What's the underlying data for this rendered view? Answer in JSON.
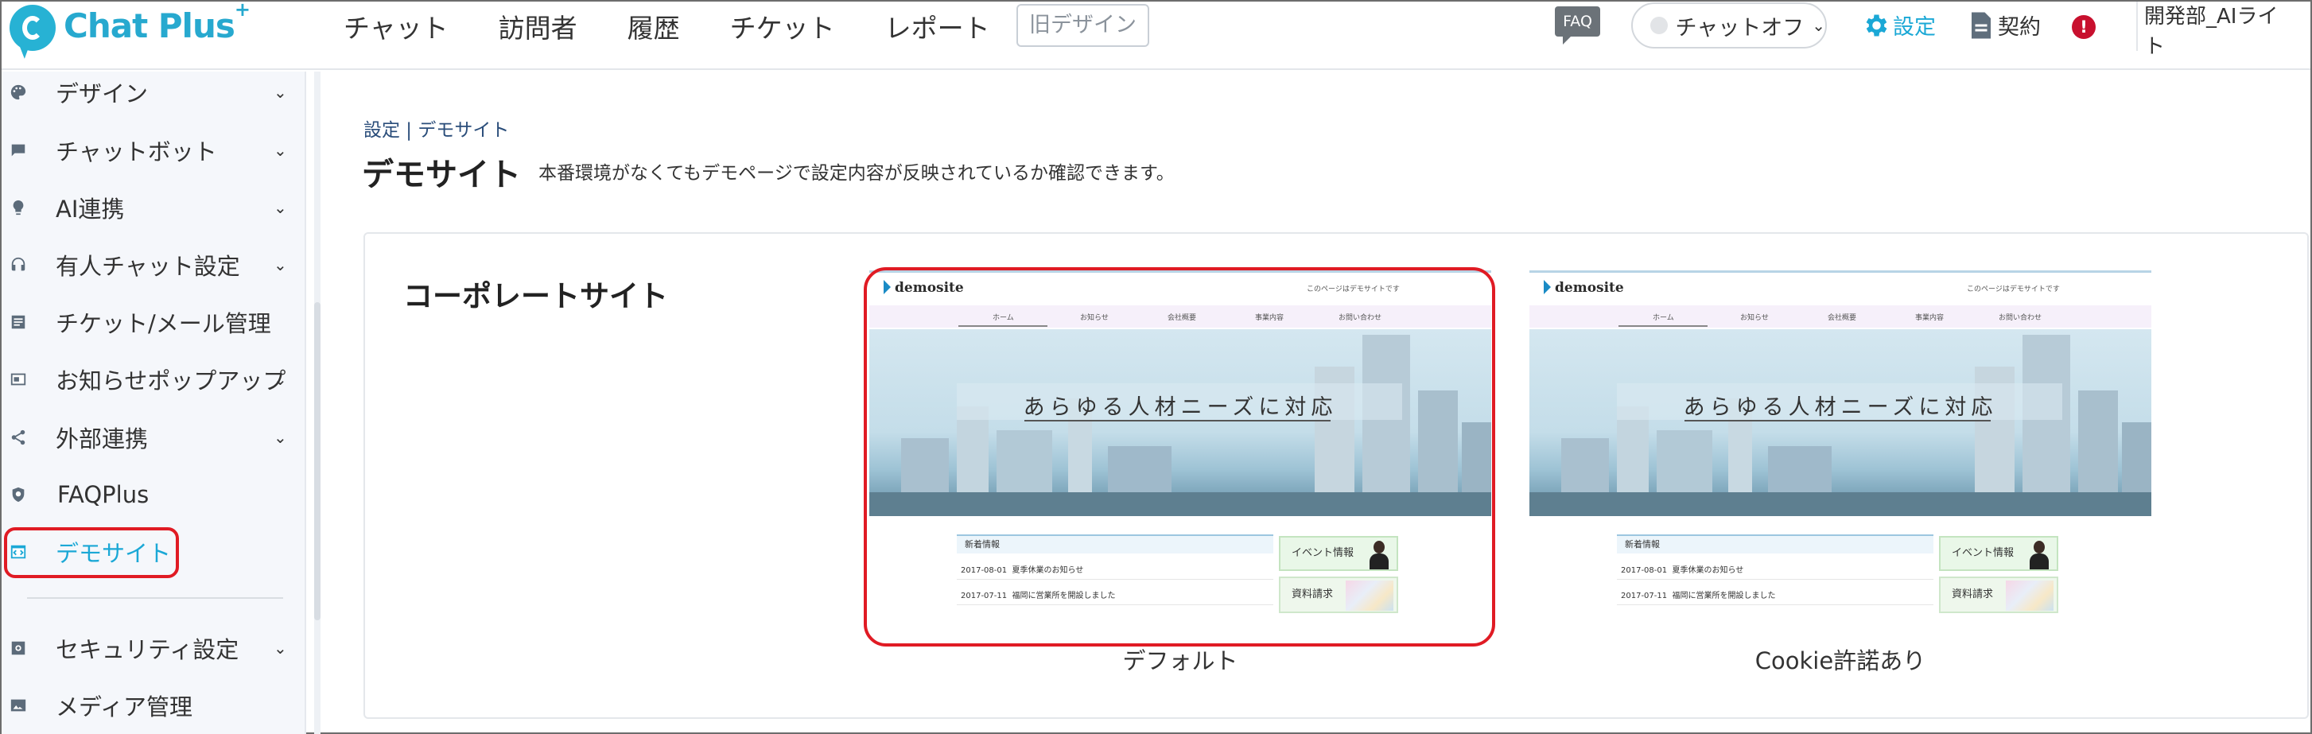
{
  "brand": {
    "name": "Chat Plus",
    "sup": "+",
    "colors": {
      "primary": "#27b2d4",
      "highlight": "#e01b24",
      "alert": "#c8102e"
    }
  },
  "topnav": [
    {
      "label": "チャット"
    },
    {
      "label": "訪問者"
    },
    {
      "label": "履歴"
    },
    {
      "label": "チケット"
    },
    {
      "label": "レポート"
    }
  ],
  "header": {
    "old_design": "旧デザイン",
    "faq_badge": "FAQ",
    "chat_status": "チャットオフ",
    "settings": "設定",
    "contract": "契約",
    "alert": "!",
    "user": "開発部_AIライト"
  },
  "sidebar": {
    "items": [
      {
        "label": "デザイン",
        "icon": "palette-icon",
        "chevron": true
      },
      {
        "label": "チャットボット",
        "icon": "chat-bubble-icon",
        "chevron": true
      },
      {
        "label": "AI連携",
        "icon": "lightbulb-icon",
        "chevron": true
      },
      {
        "label": "有人チャット設定",
        "icon": "headset-icon",
        "chevron": true
      },
      {
        "label": "チケット/メール管理",
        "icon": "ticket-list-icon",
        "chevron": false
      },
      {
        "label": "お知らせポップアップ",
        "icon": "popup-icon",
        "chevron": true
      },
      {
        "label": "外部連携",
        "icon": "share-icon",
        "chevron": true
      },
      {
        "label": "FAQPlus",
        "icon": "faq-shield-icon",
        "chevron": false
      },
      {
        "label": "デモサイト",
        "icon": "demo-site-icon",
        "chevron": false,
        "active": true
      },
      {
        "label": "セキュリティ設定",
        "icon": "security-icon",
        "chevron": true
      },
      {
        "label": "メディア管理",
        "icon": "image-icon",
        "chevron": false
      }
    ]
  },
  "main": {
    "breadcrumb": "設定 | デモサイト",
    "title": "デモサイト",
    "description": "本番環境がなくてもデモページで設定内容が反映されているか確認できます。",
    "card": {
      "title": "コーポレートサイト",
      "demo": {
        "logo": "demosite",
        "note": "このページはデモサイトです",
        "nav": [
          "ホーム",
          "お知らせ",
          "会社概要",
          "事業内容",
          "お問い合わせ"
        ],
        "hero_copy": "あらゆる人材ニーズに対応",
        "news_title": "新着情報",
        "news": [
          {
            "date": "2017-08-01",
            "text": "夏季休業のお知らせ"
          },
          {
            "date": "2017-07-11",
            "text": "福岡に営業所を開設しました"
          }
        ],
        "event_label": "イベント情報",
        "doc_label": "資料請求"
      },
      "thumbs": [
        {
          "label": "デフォルト"
        },
        {
          "label": "Cookie許諾あり"
        }
      ]
    }
  }
}
